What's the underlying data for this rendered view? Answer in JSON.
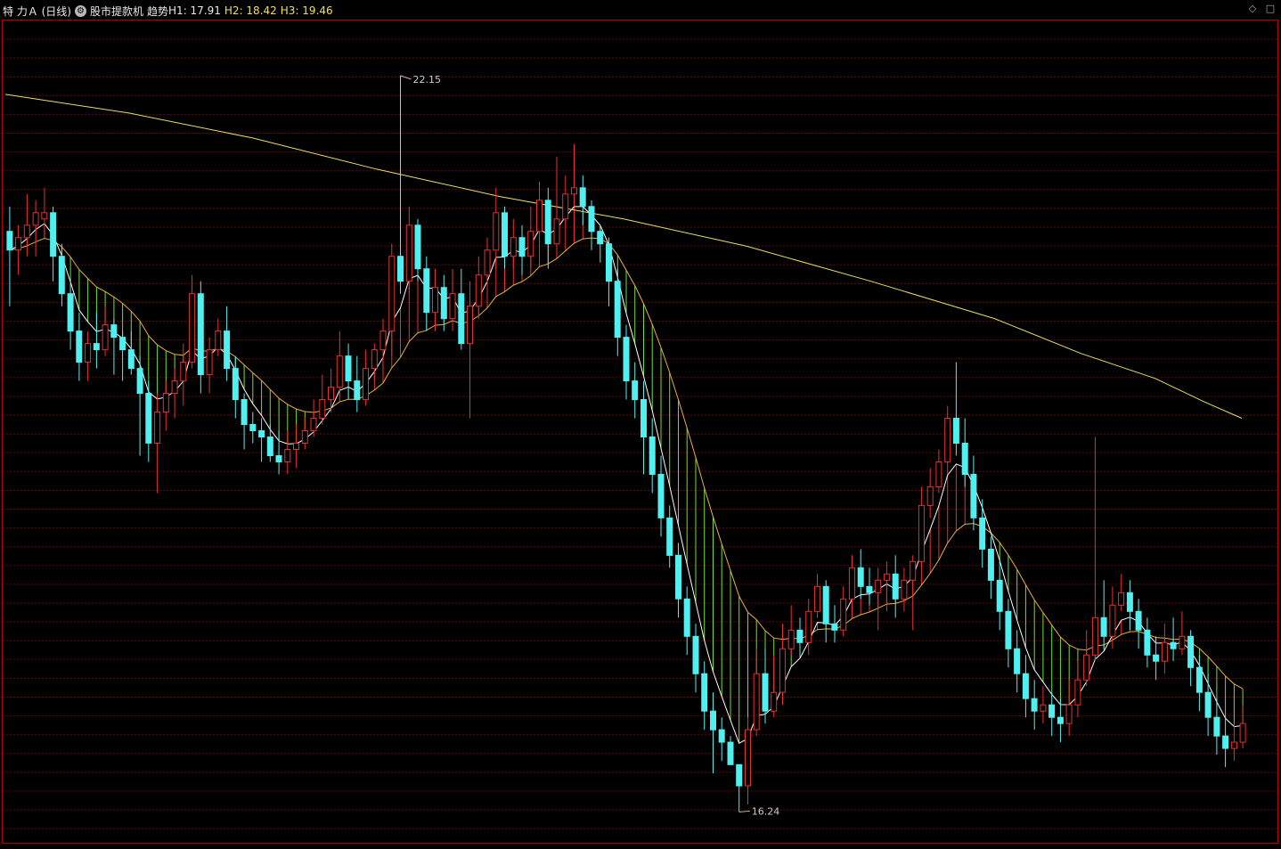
{
  "header": {
    "title": "特 力Ａ (日线)",
    "indicator_name": "股市提款机",
    "indicator_sub": "趋势",
    "h1": "H1: 17.91",
    "h2": "H2: 18.42",
    "h3": "H3: 19.46"
  },
  "top_right": {
    "diamond_icon": "diamond-icon",
    "square_icon": "square-icon"
  },
  "colors": {
    "background": "#000000",
    "border": "#b00000",
    "grid": "#6a0000",
    "up_candle": "#e83030",
    "down_candle": "#50f0f0",
    "long_ma": "#e8e060",
    "trend_line": "#ffffff",
    "band_up": "#e83030",
    "band_down": "#70e030"
  },
  "chart_data": {
    "type": "candlestick",
    "high_marker": "22.15",
    "low_marker": "16.24",
    "ylim": [
      16.0,
      22.6
    ],
    "candles": [
      [
        20.9,
        20.75,
        21.1,
        20.3
      ],
      [
        20.75,
        20.85,
        20.95,
        20.55
      ],
      [
        20.85,
        20.95,
        21.2,
        20.7
      ],
      [
        20.95,
        21.05,
        21.15,
        20.7
      ],
      [
        21.0,
        21.05,
        21.25,
        20.85
      ],
      [
        21.05,
        20.7,
        21.1,
        20.5
      ],
      [
        20.7,
        20.4,
        20.8,
        20.3
      ],
      [
        20.4,
        20.1,
        20.5,
        19.95
      ],
      [
        20.1,
        19.85,
        20.25,
        19.7
      ],
      [
        19.85,
        20.0,
        20.1,
        19.7
      ],
      [
        20.0,
        19.95,
        20.25,
        19.8
      ],
      [
        19.95,
        20.15,
        20.3,
        19.9
      ],
      [
        20.15,
        20.05,
        20.2,
        19.75
      ],
      [
        20.05,
        19.95,
        20.1,
        19.7
      ],
      [
        19.95,
        19.8,
        20.1,
        19.75
      ],
      [
        19.8,
        19.6,
        19.9,
        19.1
      ],
      [
        19.6,
        19.2,
        19.7,
        19.05
      ],
      [
        19.2,
        19.45,
        19.6,
        18.8
      ],
      [
        19.45,
        19.6,
        19.7,
        19.3
      ],
      [
        19.6,
        19.7,
        19.8,
        19.4
      ],
      [
        19.7,
        19.85,
        20.0,
        19.5
      ],
      [
        19.85,
        20.4,
        20.55,
        19.8
      ],
      [
        20.4,
        19.75,
        20.5,
        19.6
      ],
      [
        19.75,
        19.95,
        20.05,
        19.6
      ],
      [
        19.95,
        20.1,
        20.2,
        19.9
      ],
      [
        20.1,
        19.8,
        20.3,
        19.7
      ],
      [
        19.8,
        19.55,
        19.9,
        19.4
      ],
      [
        19.55,
        19.35,
        19.6,
        19.15
      ],
      [
        19.35,
        19.3,
        19.45,
        19.2
      ],
      [
        19.3,
        19.25,
        19.4,
        19.05
      ],
      [
        19.25,
        19.1,
        19.35,
        19.05
      ],
      [
        19.1,
        19.05,
        19.3,
        18.95
      ],
      [
        19.05,
        19.15,
        19.3,
        18.95
      ],
      [
        19.15,
        19.2,
        19.35,
        19.0
      ],
      [
        19.2,
        19.3,
        19.4,
        19.15
      ],
      [
        19.3,
        19.4,
        19.55,
        19.25
      ],
      [
        19.4,
        19.55,
        19.75,
        19.35
      ],
      [
        19.55,
        19.65,
        19.8,
        19.45
      ],
      [
        19.65,
        19.9,
        20.1,
        19.6
      ],
      [
        19.9,
        19.7,
        20.0,
        19.55
      ],
      [
        19.7,
        19.55,
        19.9,
        19.45
      ],
      [
        19.55,
        19.8,
        19.95,
        19.5
      ],
      [
        19.8,
        19.95,
        20.0,
        19.7
      ],
      [
        19.95,
        20.1,
        20.2,
        19.85
      ],
      [
        20.1,
        20.7,
        20.8,
        19.9
      ],
      [
        20.7,
        20.5,
        22.15,
        20.4
      ],
      [
        20.5,
        20.95,
        21.1,
        20.4
      ],
      [
        20.95,
        20.6,
        21.0,
        20.5
      ],
      [
        20.6,
        20.25,
        20.7,
        20.1
      ],
      [
        20.25,
        20.45,
        20.6,
        20.1
      ],
      [
        20.45,
        20.2,
        20.55,
        20.1
      ],
      [
        20.2,
        20.4,
        20.6,
        20.1
      ],
      [
        20.4,
        20.0,
        20.6,
        19.95
      ],
      [
        20.0,
        20.3,
        20.5,
        19.4
      ],
      [
        20.3,
        20.55,
        20.7,
        20.2
      ],
      [
        20.55,
        20.75,
        20.85,
        20.4
      ],
      [
        20.75,
        21.05,
        21.25,
        20.6
      ],
      [
        21.05,
        20.7,
        21.1,
        20.6
      ],
      [
        20.7,
        20.85,
        21.0,
        20.6
      ],
      [
        20.85,
        20.7,
        20.95,
        20.55
      ],
      [
        20.7,
        20.9,
        21.1,
        20.6
      ],
      [
        20.9,
        21.15,
        21.3,
        20.8
      ],
      [
        21.15,
        20.8,
        21.25,
        20.6
      ],
      [
        20.8,
        21.0,
        21.5,
        20.8
      ],
      [
        21.0,
        21.2,
        21.35,
        20.95
      ],
      [
        21.2,
        21.25,
        21.6,
        21.1
      ],
      [
        21.25,
        21.1,
        21.35,
        20.95
      ],
      [
        21.1,
        20.9,
        21.15,
        20.75
      ],
      [
        20.9,
        20.8,
        20.95,
        20.65
      ],
      [
        20.8,
        20.5,
        20.85,
        20.3
      ],
      [
        20.5,
        20.05,
        20.6,
        19.9
      ],
      [
        20.05,
        19.7,
        20.15,
        19.55
      ],
      [
        19.7,
        19.55,
        19.85,
        19.4
      ],
      [
        19.55,
        19.25,
        19.7,
        18.95
      ],
      [
        19.25,
        18.95,
        19.4,
        18.8
      ],
      [
        18.95,
        18.6,
        19.1,
        18.45
      ],
      [
        18.6,
        18.3,
        18.7,
        18.2
      ],
      [
        18.3,
        17.95,
        18.4,
        17.8
      ],
      [
        17.95,
        17.65,
        18.05,
        17.5
      ],
      [
        17.65,
        17.35,
        17.75,
        17.2
      ],
      [
        17.35,
        17.05,
        17.45,
        16.9
      ],
      [
        17.05,
        16.9,
        17.2,
        16.55
      ],
      [
        16.9,
        16.8,
        17.0,
        16.65
      ],
      [
        16.8,
        16.62,
        16.85,
        16.62
      ],
      [
        16.62,
        16.45,
        16.62,
        16.24
      ],
      [
        16.45,
        16.9,
        17.0,
        16.3
      ],
      [
        16.9,
        17.35,
        17.55,
        16.85
      ],
      [
        17.35,
        17.05,
        17.55,
        16.95
      ],
      [
        17.05,
        17.2,
        17.5,
        17.0
      ],
      [
        17.2,
        17.55,
        17.75,
        17.1
      ],
      [
        17.55,
        17.7,
        17.9,
        17.5
      ],
      [
        17.7,
        17.6,
        17.8,
        17.5
      ],
      [
        17.6,
        17.85,
        17.95,
        17.5
      ],
      [
        17.85,
        18.05,
        18.15,
        17.8
      ],
      [
        18.05,
        17.75,
        18.1,
        17.6
      ],
      [
        17.75,
        17.7,
        17.9,
        17.6
      ],
      [
        17.7,
        17.95,
        18.05,
        17.65
      ],
      [
        17.95,
        18.2,
        18.3,
        17.9
      ],
      [
        18.2,
        18.05,
        18.35,
        17.95
      ],
      [
        18.05,
        18.0,
        18.2,
        17.9
      ],
      [
        18.0,
        18.1,
        18.2,
        17.7
      ],
      [
        18.1,
        18.15,
        18.25,
        17.85
      ],
      [
        18.15,
        17.95,
        18.3,
        17.8
      ],
      [
        17.95,
        18.1,
        18.2,
        17.85
      ],
      [
        18.1,
        18.25,
        18.3,
        17.7
      ],
      [
        18.25,
        18.7,
        18.85,
        18.2
      ],
      [
        18.7,
        18.85,
        19.0,
        18.6
      ],
      [
        18.85,
        19.05,
        19.15,
        18.8
      ],
      [
        19.05,
        19.4,
        19.5,
        18.95
      ],
      [
        19.4,
        19.2,
        19.85,
        19.1
      ],
      [
        19.2,
        18.95,
        19.4,
        18.85
      ],
      [
        18.95,
        18.6,
        19.1,
        18.5
      ],
      [
        18.6,
        18.35,
        18.75,
        18.2
      ],
      [
        18.35,
        18.1,
        18.45,
        17.95
      ],
      [
        18.1,
        17.85,
        18.25,
        17.7
      ],
      [
        17.85,
        17.55,
        17.95,
        17.4
      ],
      [
        17.55,
        17.35,
        17.7,
        17.2
      ],
      [
        17.35,
        17.15,
        17.5,
        17.0
      ],
      [
        17.15,
        17.05,
        17.3,
        16.9
      ],
      [
        17.05,
        17.1,
        17.25,
        16.95
      ],
      [
        17.1,
        17.0,
        17.2,
        16.85
      ],
      [
        17.0,
        16.95,
        17.15,
        16.8
      ],
      [
        16.95,
        17.1,
        17.3,
        16.85
      ],
      [
        17.1,
        17.3,
        17.45,
        17.0
      ],
      [
        17.3,
        17.5,
        17.7,
        17.25
      ],
      [
        17.5,
        17.8,
        19.25,
        17.45
      ],
      [
        17.8,
        17.65,
        18.1,
        17.55
      ],
      [
        17.65,
        17.9,
        18.05,
        17.55
      ],
      [
        17.9,
        18.0,
        18.15,
        17.85
      ],
      [
        18.0,
        17.85,
        18.1,
        17.7
      ],
      [
        17.85,
        17.7,
        17.95,
        17.55
      ],
      [
        17.7,
        17.5,
        17.8,
        17.4
      ],
      [
        17.5,
        17.45,
        17.65,
        17.3
      ],
      [
        17.45,
        17.6,
        17.75,
        17.35
      ],
      [
        17.6,
        17.55,
        17.8,
        17.45
      ],
      [
        17.55,
        17.65,
        17.85,
        17.5
      ],
      [
        17.65,
        17.4,
        17.7,
        17.25
      ],
      [
        17.4,
        17.2,
        17.5,
        17.05
      ],
      [
        17.2,
        17.0,
        17.35,
        16.85
      ],
      [
        17.0,
        16.85,
        17.15,
        16.7
      ],
      [
        16.85,
        16.75,
        17.0,
        16.6
      ],
      [
        16.75,
        16.8,
        16.95,
        16.65
      ],
      [
        16.8,
        16.95,
        17.1,
        16.75
      ]
    ],
    "ma_long": [
      [
        0,
        22.0
      ],
      [
        0.1,
        21.85
      ],
      [
        0.2,
        21.65
      ],
      [
        0.3,
        21.4
      ],
      [
        0.4,
        21.18
      ],
      [
        0.5,
        21.0
      ],
      [
        0.6,
        20.78
      ],
      [
        0.7,
        20.5
      ],
      [
        0.8,
        20.2
      ],
      [
        0.87,
        19.92
      ],
      [
        0.93,
        19.72
      ],
      [
        0.97,
        19.53
      ],
      [
        1.0,
        19.4
      ]
    ]
  }
}
